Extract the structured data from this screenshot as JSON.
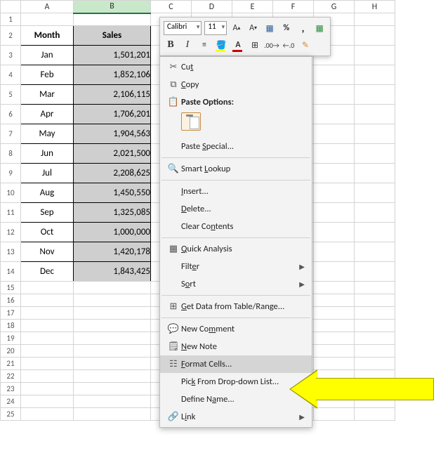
{
  "columns": [
    "A",
    "B",
    "C",
    "D",
    "E",
    "F",
    "G",
    "H"
  ],
  "headers": {
    "month": "Month",
    "sales": "Sales"
  },
  "rows": [
    {
      "n": "3",
      "month": "Jan",
      "sales": "1,501,201"
    },
    {
      "n": "4",
      "month": "Feb",
      "sales": "1,852,106"
    },
    {
      "n": "5",
      "month": "Mar",
      "sales": "2,106,115"
    },
    {
      "n": "6",
      "month": "Apr",
      "sales": "1,706,201"
    },
    {
      "n": "7",
      "month": "May",
      "sales": "1,904,563"
    },
    {
      "n": "8",
      "month": "Jun",
      "sales": "2,021,500"
    },
    {
      "n": "9",
      "month": "Jul",
      "sales": "2,208,625"
    },
    {
      "n": "10",
      "month": "Aug",
      "sales": "1,450,550"
    },
    {
      "n": "11",
      "month": "Sep",
      "sales": "1,325,085"
    },
    {
      "n": "12",
      "month": "Oct",
      "sales": "1,000,000"
    },
    {
      "n": "13",
      "month": "Nov",
      "sales": "1,420,178"
    },
    {
      "n": "14",
      "month": "Dec",
      "sales": "1,843,425"
    }
  ],
  "mini": {
    "font": "Calibri",
    "size": "11"
  },
  "ctx": {
    "cut": "Cut",
    "copy": "Copy",
    "paste_options": "Paste Options:",
    "paste_special": "Paste Special...",
    "smart_lookup": "Smart Lookup",
    "insert": "Insert...",
    "delete": "Delete...",
    "clear": "Clear Contents",
    "quick": "Quick Analysis",
    "filter": "Filter",
    "sort": "Sort",
    "get_data": "Get Data from Table/Range...",
    "new_comment": "New Comment",
    "new_note": "New Note",
    "format_cells": "Format Cells...",
    "pick": "Pick From Drop-down List...",
    "define": "Define Name...",
    "link": "Link"
  }
}
